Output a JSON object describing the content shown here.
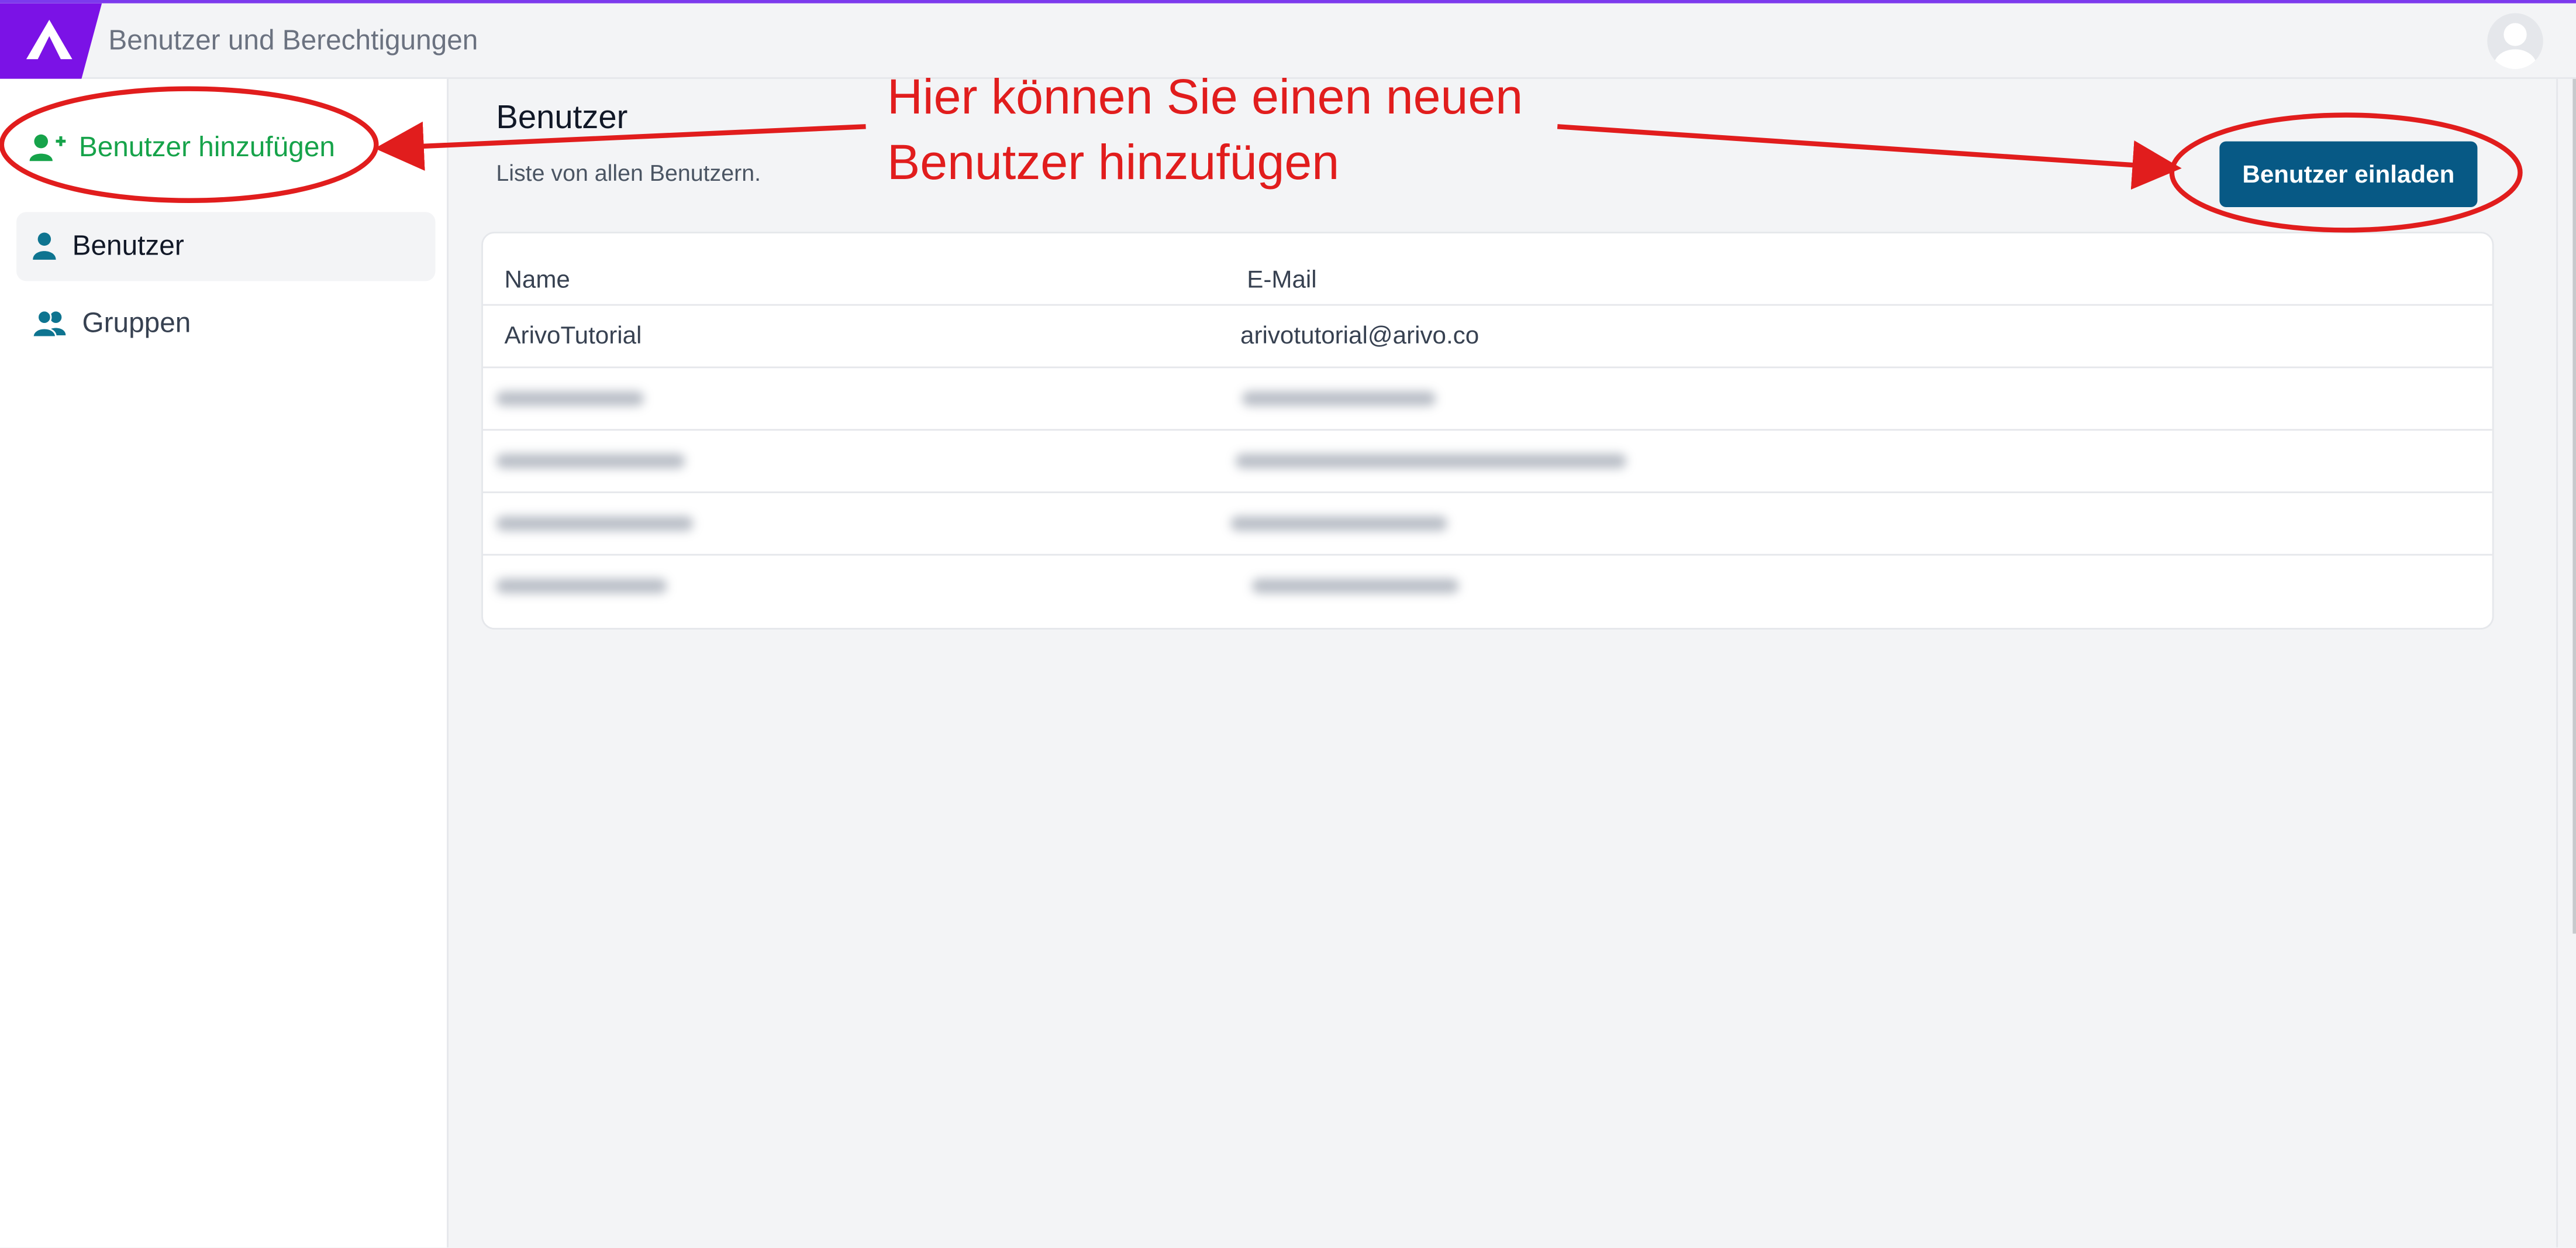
{
  "header": {
    "app_title": "Benutzer und Berechtigungen"
  },
  "sidebar": {
    "add_user_label": "Benutzer hinzufügen",
    "items": [
      {
        "label": "Benutzer",
        "icon": "user-icon",
        "active": true
      },
      {
        "label": "Gruppen",
        "icon": "users-icon",
        "active": false
      }
    ]
  },
  "main": {
    "title": "Benutzer",
    "subtitle": "Liste von allen Benutzern.",
    "invite_button_label": "Benutzer einladen",
    "table": {
      "columns": [
        "Name",
        "E-Mail"
      ],
      "rows": [
        {
          "name": "ArivoTutorial",
          "email": "arivotutorial@arivo.co"
        }
      ]
    }
  },
  "annotation": {
    "line1": "Hier können Sie einen neuen",
    "line2": "Benutzer hinzufügen",
    "color": "#e11d1d"
  },
  "colors": {
    "brand": "#7b12e6",
    "primary_button": "#075985",
    "add_user_green": "#16a34a",
    "nav_icon_blue": "#0e7490"
  }
}
